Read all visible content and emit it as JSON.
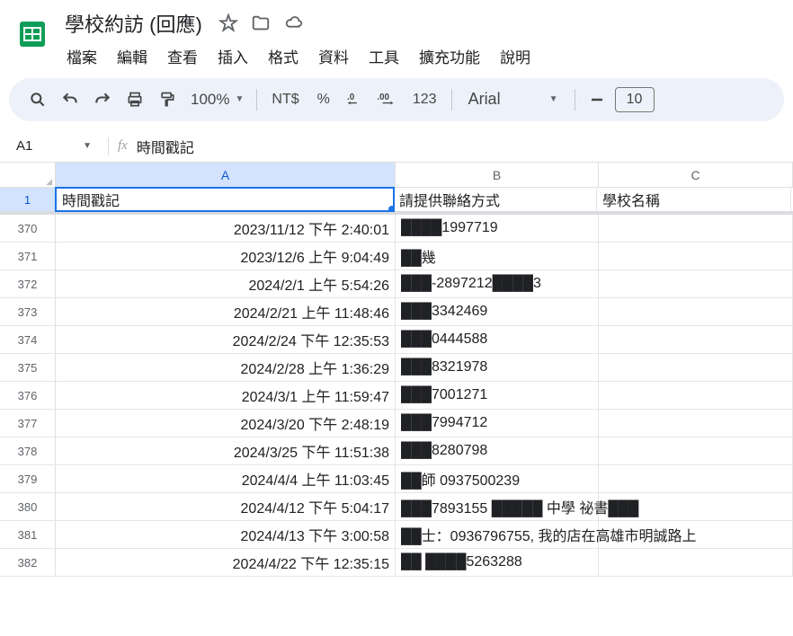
{
  "doc": {
    "title": "學校約訪 (回應)"
  },
  "menu": {
    "file": "檔案",
    "edit": "編輯",
    "view": "查看",
    "insert": "插入",
    "format": "格式",
    "data": "資料",
    "tools": "工具",
    "extensions": "擴充功能",
    "help": "說明"
  },
  "toolbar": {
    "zoom": "100%",
    "currency": "NT$",
    "percent": "%",
    "numfmt": "123",
    "font": "Arial",
    "size": "10"
  },
  "nameBox": "A1",
  "formula": "時間戳記",
  "columns": {
    "a": "A",
    "b": "B",
    "c": "C"
  },
  "headerRow": {
    "num": "1",
    "a": "時間戳記",
    "b": "請提供聯絡方式",
    "c": "學校名稱"
  },
  "rows": [
    {
      "n": "370",
      "a": "2023/11/12 下午 2:40:01",
      "b": "████1997719",
      "c": ""
    },
    {
      "n": "371",
      "a": "2023/12/6 上午 9:04:49",
      "b": "██幾",
      "c": ""
    },
    {
      "n": "372",
      "a": "2024/2/1 上午 5:54:26",
      "b": "███-2897212████3",
      "c": ""
    },
    {
      "n": "373",
      "a": "2024/2/21 上午 11:48:46",
      "b": "███3342469",
      "c": ""
    },
    {
      "n": "374",
      "a": "2024/2/24 下午 12:35:53",
      "b": "███0444588",
      "c": ""
    },
    {
      "n": "375",
      "a": "2024/2/28 上午 1:36:29",
      "b": "███8321978",
      "c": ""
    },
    {
      "n": "376",
      "a": "2024/3/1 上午 11:59:47",
      "b": "███7001271",
      "c": ""
    },
    {
      "n": "377",
      "a": "2024/3/20 下午 2:48:19",
      "b": "███7994712",
      "c": ""
    },
    {
      "n": "378",
      "a": "2024/3/25 下午 11:51:38",
      "b": "███8280798",
      "c": ""
    },
    {
      "n": "379",
      "a": "2024/4/4 上午 11:03:45",
      "b": "██師 0937500239",
      "c": ""
    },
    {
      "n": "380",
      "a": "2024/4/12 下午 5:04:17",
      "b": "███7893155 █████ 中學 祕書███",
      "c": ""
    },
    {
      "n": "381",
      "a": "2024/4/13 下午 3:00:58",
      "b": "██士：0936796755, 我的店在高雄市明誠路上",
      "c": ""
    },
    {
      "n": "382",
      "a": "2024/4/22 下午 12:35:15",
      "b": "██ ████5263288",
      "c": ""
    }
  ]
}
